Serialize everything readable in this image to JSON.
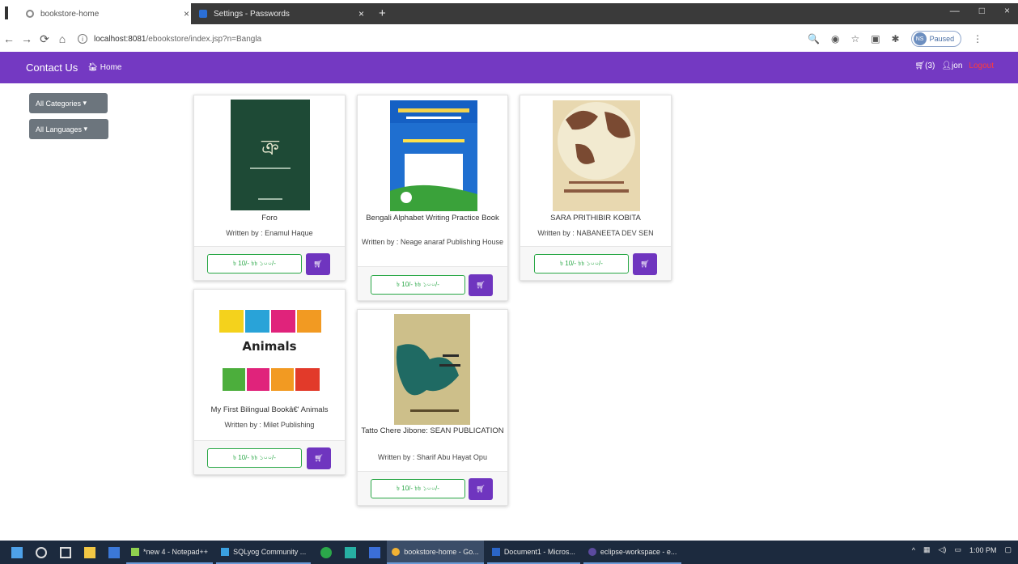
{
  "browser": {
    "tabs": [
      {
        "title": "bookstore-home",
        "close": "×"
      },
      {
        "title": "Settings - Passwords",
        "close": "×"
      }
    ],
    "new_tab": "+",
    "window_controls": [
      "—",
      "□",
      "×"
    ],
    "url_host": "localhost:8081",
    "url_path": "/ebookstore/index.jsp?n=Bangla",
    "profile_initials": "NS",
    "profile_status": "Paused"
  },
  "navbar": {
    "brand": "Contact Us",
    "home": "Home",
    "cart_count": "(3)",
    "user": "jon",
    "logout": "Logout"
  },
  "sidebar": {
    "categories": "All Categories",
    "languages": "All Languages"
  },
  "books": [
    {
      "title": "Foro",
      "author": "Written by : Enamul Haque",
      "price": "৳ 10/- ৳৳ ১০০/-",
      "cover_color": "#1e4a36"
    },
    {
      "title": "Bengali Alphabet Writing Practice Book",
      "author": "Written by : Neage anaraf Publishing House",
      "price": "৳ 10/- ৳৳ ১০০/-",
      "cover_color": "#1f6fd0"
    },
    {
      "title": "SARA PRITHIBIR KOBITA",
      "author": "Written by : NABANEETA DEV SEN",
      "price": "৳ 10/- ৳৳ ১০০/-",
      "cover_color": "#e8d8b0"
    },
    {
      "title": "My First Bilingual Bookâ€' Animals",
      "author": "Written by : Milet Publishing",
      "price": "৳ 10/- ৳৳ ১০০/-",
      "cover_color": "#ffffff"
    },
    {
      "title": "Tatto Chere Jibone: SEAN PUBLICATION",
      "author": "Written by : Sharif Abu Hayat Opu",
      "price": "৳ 10/- ৳৳ ১০০/-",
      "cover_color": "#cdbf8a"
    }
  ],
  "taskbar": {
    "apps": [
      {
        "label": "*new 4 - Notepad++"
      },
      {
        "label": "SQLyog Community ..."
      },
      {
        "label": "bookstore-home - Go..."
      },
      {
        "label": "Document1 - Micros..."
      },
      {
        "label": "eclipse-workspace - e..."
      }
    ],
    "time": "1:00 PM"
  },
  "colors": {
    "navbar": "#7439c2",
    "cart_button": "#6f35bf",
    "price_outline": "#28a745",
    "dropdown": "#6c757d"
  }
}
